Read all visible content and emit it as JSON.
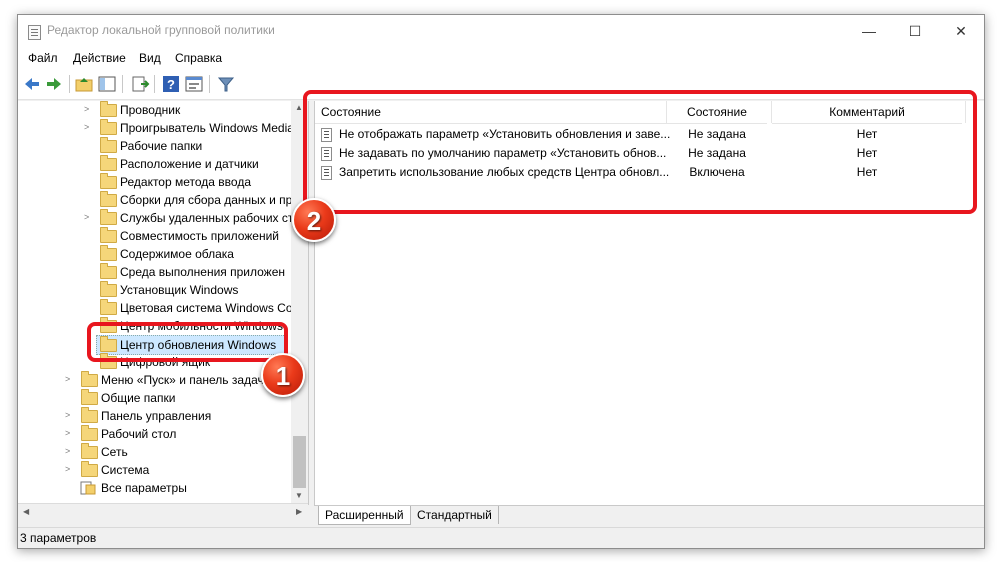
{
  "window": {
    "title": "Редактор локальной групповой политики",
    "controls": {
      "minimize": "—",
      "maximize": "☐",
      "close": "✕"
    }
  },
  "menu": [
    "Файл",
    "Действие",
    "Вид",
    "Справка"
  ],
  "toolbar_icons": [
    "back-arrow-icon",
    "forward-arrow-icon",
    "up-folder-icon",
    "show-tree-icon",
    "export-list-icon",
    "help-icon",
    "properties-icon",
    "filter-icon"
  ],
  "tree": {
    "items": [
      {
        "label": "Проводник",
        "expandable": true
      },
      {
        "label": "Проигрыватель Windows Media",
        "expandable": true
      },
      {
        "label": "Рабочие папки",
        "expandable": false
      },
      {
        "label": "Расположение и датчики",
        "expandable": false
      },
      {
        "label": "Редактор метода ввода",
        "expandable": false
      },
      {
        "label": "Сборки для сбора данных и пр",
        "expandable": false
      },
      {
        "label": "Службы удаленных рабочих ст",
        "expandable": true
      },
      {
        "label": "Совместимость приложений",
        "expandable": false
      },
      {
        "label": "Содержимое облака",
        "expandable": false
      },
      {
        "label": "Среда выполнения приложен",
        "expandable": false
      },
      {
        "label": "Установщик Windows",
        "expandable": false
      },
      {
        "label": "Цветовая система Windows Col",
        "expandable": false
      },
      {
        "label": "Центр мобильности Windows",
        "expandable": false
      },
      {
        "label": "Центр обновления Windows",
        "expandable": false,
        "selected": true
      },
      {
        "label": "Цифровой ящик",
        "expandable": false
      }
    ],
    "top_items": [
      {
        "label": "Меню «Пуск» и панель задач",
        "expandable": true
      },
      {
        "label": "Общие папки",
        "expandable": false
      },
      {
        "label": "Панель управления",
        "expandable": true
      },
      {
        "label": "Рабочий стол",
        "expandable": true
      },
      {
        "label": "Сеть",
        "expandable": true
      },
      {
        "label": "Система",
        "expandable": true
      },
      {
        "label": "Все параметры",
        "expandable": false
      }
    ]
  },
  "list": {
    "columns": [
      "Состояние",
      "Состояние",
      "Комментарий"
    ],
    "rows": [
      {
        "name": "Не отображать параметр «Установить обновления и заве...",
        "state": "Не задана",
        "comment": "Нет"
      },
      {
        "name": "Не задавать по умолчанию параметр «Установить обнов...",
        "state": "Не задана",
        "comment": "Нет"
      },
      {
        "name": "Запретить использование любых средств Центра обновл...",
        "state": "Включена",
        "comment": "Нет"
      }
    ]
  },
  "tabs": [
    "Расширенный",
    "Стандартный"
  ],
  "status": "3 параметров",
  "annotations": {
    "badge1": "1",
    "badge2": "2",
    "color": "#e8161e"
  }
}
